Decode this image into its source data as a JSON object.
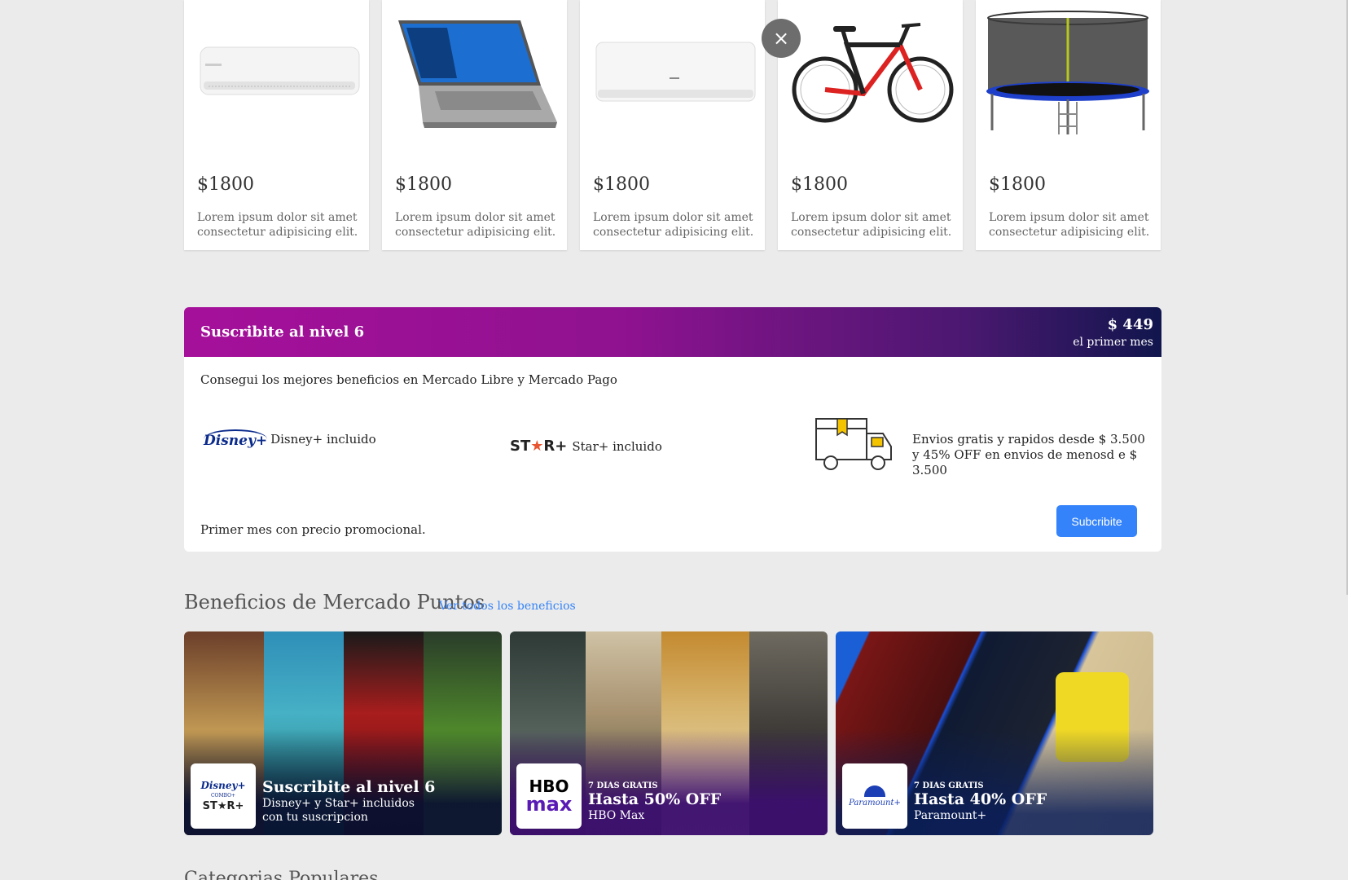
{
  "products": [
    {
      "price": "$1800",
      "description": "Lorem ipsum dolor sit amet consectetur adipisicing elit.",
      "image": "air-conditioner"
    },
    {
      "price": "$1800",
      "description": "Lorem ipsum dolor sit amet consectetur adipisicing elit.",
      "image": "laptop"
    },
    {
      "price": "$1800",
      "description": "Lorem ipsum dolor sit amet consectetur adipisicing elit.",
      "image": "air-conditioner"
    },
    {
      "price": "$1800",
      "description": "Lorem ipsum dolor sit amet consectetur adipisicing elit.",
      "image": "bicycle"
    },
    {
      "price": "$1800",
      "description": "Lorem ipsum dolor sit amet consectetur adipisicing elit.",
      "image": "trampoline"
    }
  ],
  "close_icon": "×",
  "subscription": {
    "title": "Suscribite al nivel 6",
    "price": "$ 449",
    "price_note": "el primer mes",
    "description": "Consegui los mejores beneficios en Mercado Libre y Mercado Pago",
    "disney_logo": "Disney+",
    "disney_label": "Disney+ incluido",
    "star_logo_a": "ST",
    "star_logo_b": "★",
    "star_logo_c": "R+",
    "star_label": "Star+ incluido",
    "shipping_line1": "Envios gratis y rapidos desde $ 3.500",
    "shipping_line2": "y 45% OFF en envios de menosd e $ 3.500",
    "promo_note": "Primer mes con precio promocional.",
    "button": "Subcribite",
    "colors": {
      "gradient_start": "#a5109a",
      "gradient_end": "#11164d",
      "button": "#3483fa"
    }
  },
  "benefits": {
    "title": "Beneficios de Mercado Puntos",
    "link": "Ver todos los beneficios",
    "cards": [
      {
        "logo_top": "Disney+",
        "logo_mid": "COMBO+",
        "logo_bottom": "ST★R+",
        "small": "",
        "headline": "Suscribite al nivel 6",
        "sub": "Disney+ y Star+ incluidos con tu suscripcion"
      },
      {
        "logo_top": "HBO",
        "logo_bottom": "max",
        "small": "7 DIAS GRATIS",
        "headline": "Hasta 50% OFF",
        "sub": "HBO Max"
      },
      {
        "logo_top": "Paramount+",
        "small": "7 DIAS GRATIS",
        "headline": "Hasta 40% OFF",
        "sub": "Paramount+"
      }
    ]
  },
  "categories_title": "Categorias Populares"
}
